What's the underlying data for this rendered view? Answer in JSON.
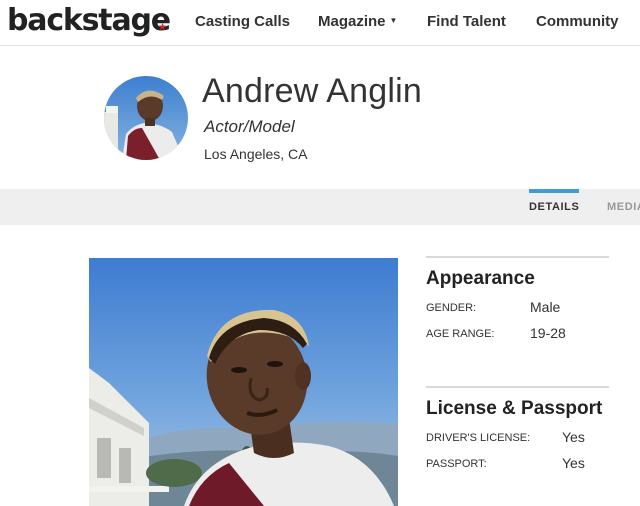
{
  "nav": {
    "logo": "backstage",
    "items": [
      {
        "label": "Casting Calls"
      },
      {
        "label": "Magazine"
      },
      {
        "label": "Find Talent"
      },
      {
        "label": "Community"
      }
    ]
  },
  "profile": {
    "name": "Andrew Anglin",
    "role": "Actor/Model",
    "location": "Los Angeles, CA"
  },
  "tabs": [
    {
      "label": "DETAILS",
      "active": true
    },
    {
      "label": "MEDIA",
      "active": false
    }
  ],
  "appearance": {
    "title": "Appearance",
    "rows": [
      {
        "label": "GENDER:",
        "value": "Male"
      },
      {
        "label": "AGE RANGE:",
        "value": "19-28"
      }
    ]
  },
  "license": {
    "title": "License & Passport",
    "rows": [
      {
        "label": "DRIVER'S LICENSE:",
        "value": "Yes"
      },
      {
        "label": "PASSPORT:",
        "value": "Yes"
      }
    ]
  },
  "colors": {
    "accent": "#3b9fd6",
    "logo_star": "#e0202b",
    "tabbar_bg": "#efefef"
  }
}
